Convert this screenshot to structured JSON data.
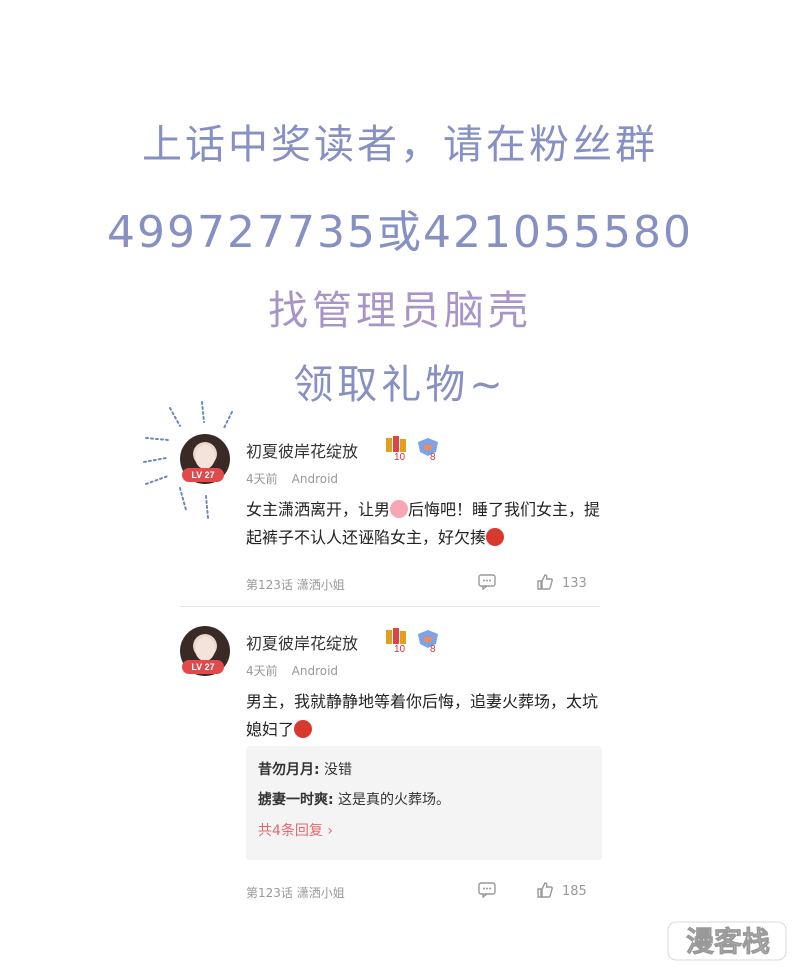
{
  "headline": {
    "line1": "上话中奖读者，请在粉丝群",
    "line2": "499727735或421055580",
    "line3": "找管理员脑壳",
    "line4": "领取礼物~"
  },
  "comments": [
    {
      "username": "初夏彼岸花绽放",
      "level": "LV 27",
      "badge1_num": "10",
      "badge2_num": "8",
      "time": "4天前",
      "device": "Android",
      "text_parts": [
        "女主潇洒离开，让男",
        "后悔吧！睡了我们女主，提起裤子不认人还诬陷女主，好欠揍"
      ],
      "chapter": "第123话 潇洒小姐",
      "likes": "133"
    },
    {
      "username": "初夏彼岸花绽放",
      "level": "LV 27",
      "badge1_num": "10",
      "badge2_num": "8",
      "time": "4天前",
      "device": "Android",
      "text": "男主，我就静静地等着你后悔，追妻火葬场，太坑媳妇了",
      "replies": [
        {
          "user": "昔勿月月:",
          "text": " 没错"
        },
        {
          "user": "掳妻一时爽:",
          "text": " 这是真的火葬场。"
        }
      ],
      "more_replies": "共4条回复",
      "chapter": "第123话 潇洒小姐",
      "likes": "185"
    }
  ],
  "watermark": "漫客栈",
  "colors": {
    "headline_blue": "#8790c2",
    "headline_purple": "#a994c8",
    "level_red": "#e04a4a",
    "reply_link": "#e8666c"
  },
  "icons": [
    "comment-icon",
    "thumbs-up-icon",
    "pig-emoji-icon",
    "angry-emoji-icon"
  ]
}
